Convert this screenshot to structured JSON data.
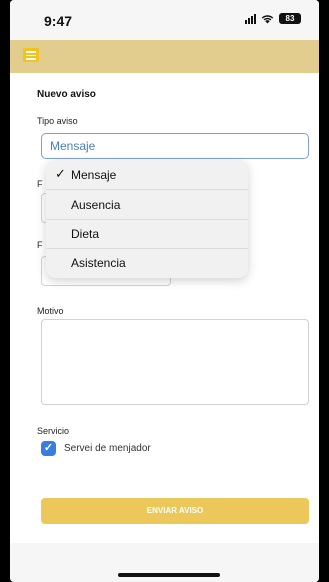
{
  "status_bar": {
    "time": "9:47",
    "battery": "83",
    "signal_icon": "signal-icon",
    "wifi_icon": "wifi-icon"
  },
  "app_bar": {
    "menu_icon": "hamburger-menu-icon",
    "color": "#e2cd8e",
    "menu_color": "#f3c21c"
  },
  "form": {
    "title": "Nuevo aviso",
    "tipo_label": "Tipo aviso",
    "tipo_value": "Mensaje",
    "fecha1_label_partial": "F",
    "fecha2_label_partial": "F",
    "motivo_label": "Motivo",
    "motivo_value": "",
    "servicio_label": "Servicio",
    "servicio_option": "Servei de menjador",
    "servicio_checked": true,
    "submit_label": "ENVIAR AVISO",
    "submit_color": "#ecc759",
    "accent_color": "#3a7de0"
  },
  "dropdown": {
    "selected_check": "✓",
    "options": [
      "Mensaje",
      "Ausencia",
      "Dieta",
      "Asistencia"
    ],
    "selected_index": 0
  }
}
